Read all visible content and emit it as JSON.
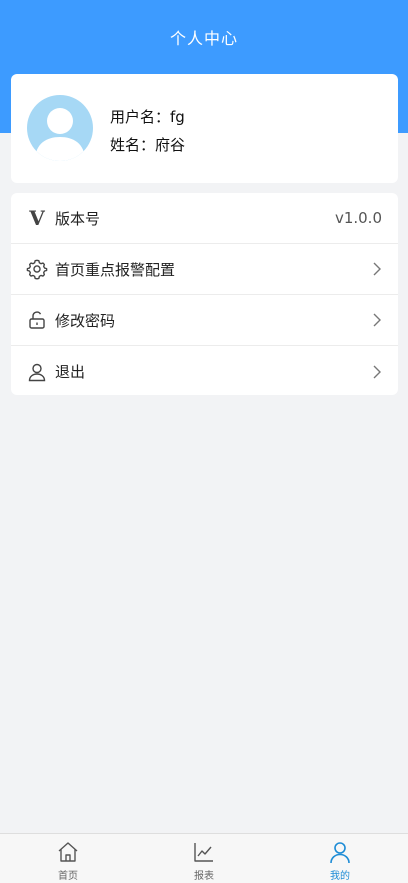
{
  "header": {
    "title": "个人中心"
  },
  "profile": {
    "username_label": "用户名：fg",
    "name_label": "姓名：府谷"
  },
  "menu": {
    "items": [
      {
        "label": "版本号",
        "value": "v1.0.0",
        "icon": "v-version-icon"
      },
      {
        "label": "首页重点报警配置",
        "icon": "gear-icon"
      },
      {
        "label": "修改密码",
        "icon": "unlock-icon"
      },
      {
        "label": "退出",
        "icon": "user-icon"
      }
    ]
  },
  "tabbar": {
    "tabs": [
      {
        "label": "首页",
        "icon": "home-icon"
      },
      {
        "label": "报表",
        "icon": "line-chart-icon"
      },
      {
        "label": "我的",
        "icon": "user-icon",
        "active": true
      }
    ]
  },
  "colors": {
    "primary": "#3d9bff",
    "active_tab": "#1d8cd6",
    "avatar_bg": "#a6d8f5"
  }
}
